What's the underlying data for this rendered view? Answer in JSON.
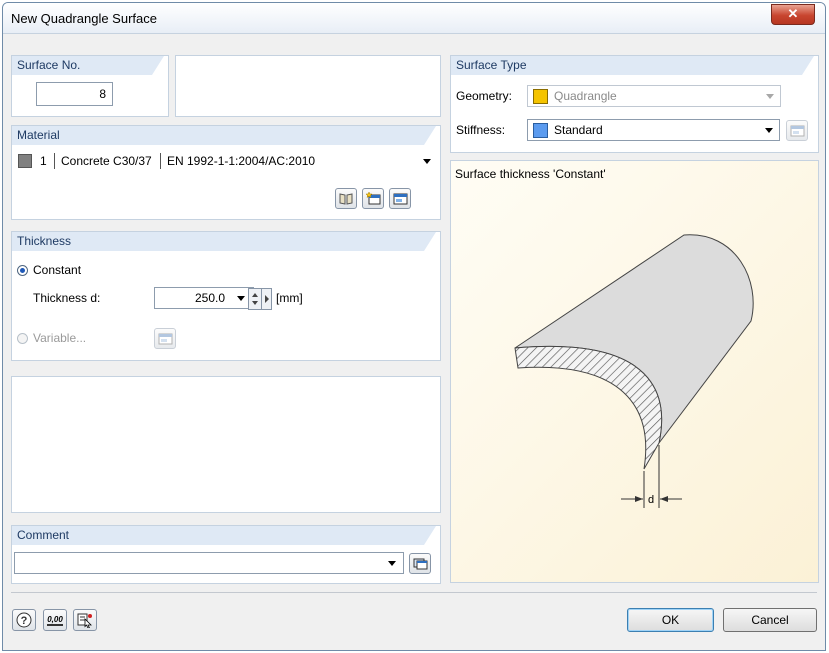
{
  "window": {
    "title": "New Quadrangle Surface",
    "close_glyph": "✕"
  },
  "surface_no": {
    "header": "Surface No.",
    "value": "8"
  },
  "material": {
    "header": "Material",
    "number": "1",
    "name": "Concrete C30/37",
    "standard": "EN 1992-1-1:2004/AC:2010",
    "color": "#808080",
    "icons": [
      "library-icon",
      "new-material-icon",
      "edit-material-icon"
    ]
  },
  "thickness": {
    "header": "Thickness",
    "constant_label": "Constant",
    "thickness_label": "Thickness d:",
    "value": "250.0",
    "unit": "[mm]",
    "variable_label": "Variable..."
  },
  "comment": {
    "header": "Comment",
    "value": ""
  },
  "surface_type": {
    "header": "Surface Type",
    "geometry_label": "Geometry:",
    "geometry_value": "Quadrangle",
    "geometry_color": "#f5c400",
    "stiffness_label": "Stiffness:",
    "stiffness_value": "Standard",
    "stiffness_color": "#5b9bef"
  },
  "preview": {
    "caption": "Surface thickness 'Constant'",
    "dim_label": "d"
  },
  "footer": {
    "ok_label": "OK",
    "cancel_label": "Cancel",
    "units_glyph": "0,00"
  }
}
